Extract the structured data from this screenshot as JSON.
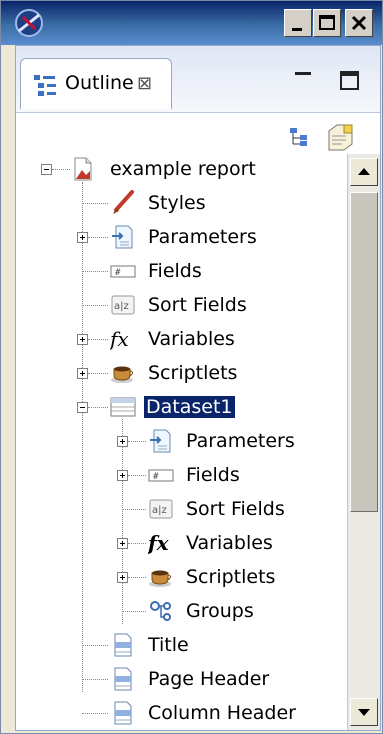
{
  "window": {
    "title": ""
  },
  "view": {
    "tab_label": "Outline",
    "close_glyph": "⊠"
  },
  "tree": [
    {
      "label": "example report",
      "icon": "report-icon",
      "expanded": true,
      "level": 0
    },
    {
      "label": "Styles",
      "icon": "styles-icon",
      "level": 1
    },
    {
      "label": "Parameters",
      "icon": "parameters-icon",
      "expandable": true,
      "level": 1
    },
    {
      "label": "Fields",
      "icon": "fields-icon",
      "level": 1
    },
    {
      "label": "Sort Fields",
      "icon": "sort-fields-icon",
      "level": 1
    },
    {
      "label": "Variables",
      "icon": "variables-icon",
      "expandable": true,
      "level": 1
    },
    {
      "label": "Scriptlets",
      "icon": "scriptlets-icon",
      "expandable": true,
      "level": 1
    },
    {
      "label": "Dataset1",
      "icon": "dataset-icon",
      "expanded": true,
      "selected": true,
      "level": 1
    },
    {
      "label": "Parameters",
      "icon": "parameters-icon",
      "expandable": true,
      "level": 2
    },
    {
      "label": "Fields",
      "icon": "fields-icon",
      "expandable": true,
      "level": 2
    },
    {
      "label": "Sort Fields",
      "icon": "sort-fields-icon",
      "level": 2
    },
    {
      "label": "Variables",
      "icon": "variables-icon",
      "expandable": true,
      "level": 2
    },
    {
      "label": "Scriptlets",
      "icon": "scriptlets-icon",
      "expandable": true,
      "level": 2
    },
    {
      "label": "Groups",
      "icon": "groups-icon",
      "level": 2
    },
    {
      "label": "Title",
      "icon": "band-icon",
      "level": 1
    },
    {
      "label": "Page Header",
      "icon": "band-icon",
      "level": 1
    },
    {
      "label": "Column Header",
      "icon": "band-icon",
      "level": 1
    }
  ],
  "colors": {
    "selection": "#0a246a",
    "title_bar": "#0a246a"
  }
}
